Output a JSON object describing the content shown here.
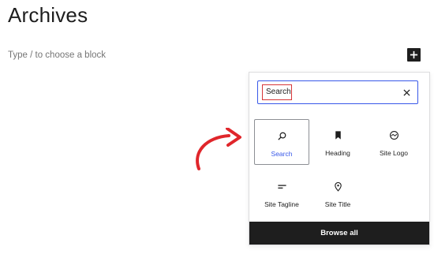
{
  "page": {
    "title": "Archives",
    "block_placeholder": "Type / to choose a block"
  },
  "toolbar": {
    "inserter_icon": "plus-icon"
  },
  "inserter": {
    "search": {
      "value": "Search",
      "clear_icon": "close-icon"
    },
    "blocks": [
      {
        "label": "Search",
        "icon": "search-icon",
        "selected": true
      },
      {
        "label": "Heading",
        "icon": "bookmark-icon",
        "selected": false
      },
      {
        "label": "Site Logo",
        "icon": "site-logo-icon",
        "selected": false
      },
      {
        "label": "Site Tagline",
        "icon": "tagline-icon",
        "selected": false
      },
      {
        "label": "Site Title",
        "icon": "map-pin-icon",
        "selected": false
      }
    ],
    "browse_all_label": "Browse all"
  },
  "colors": {
    "accent": "#3858e9",
    "highlight": "#d63638",
    "annotation_arrow": "#e0262b",
    "dark": "#1e1e1e"
  }
}
